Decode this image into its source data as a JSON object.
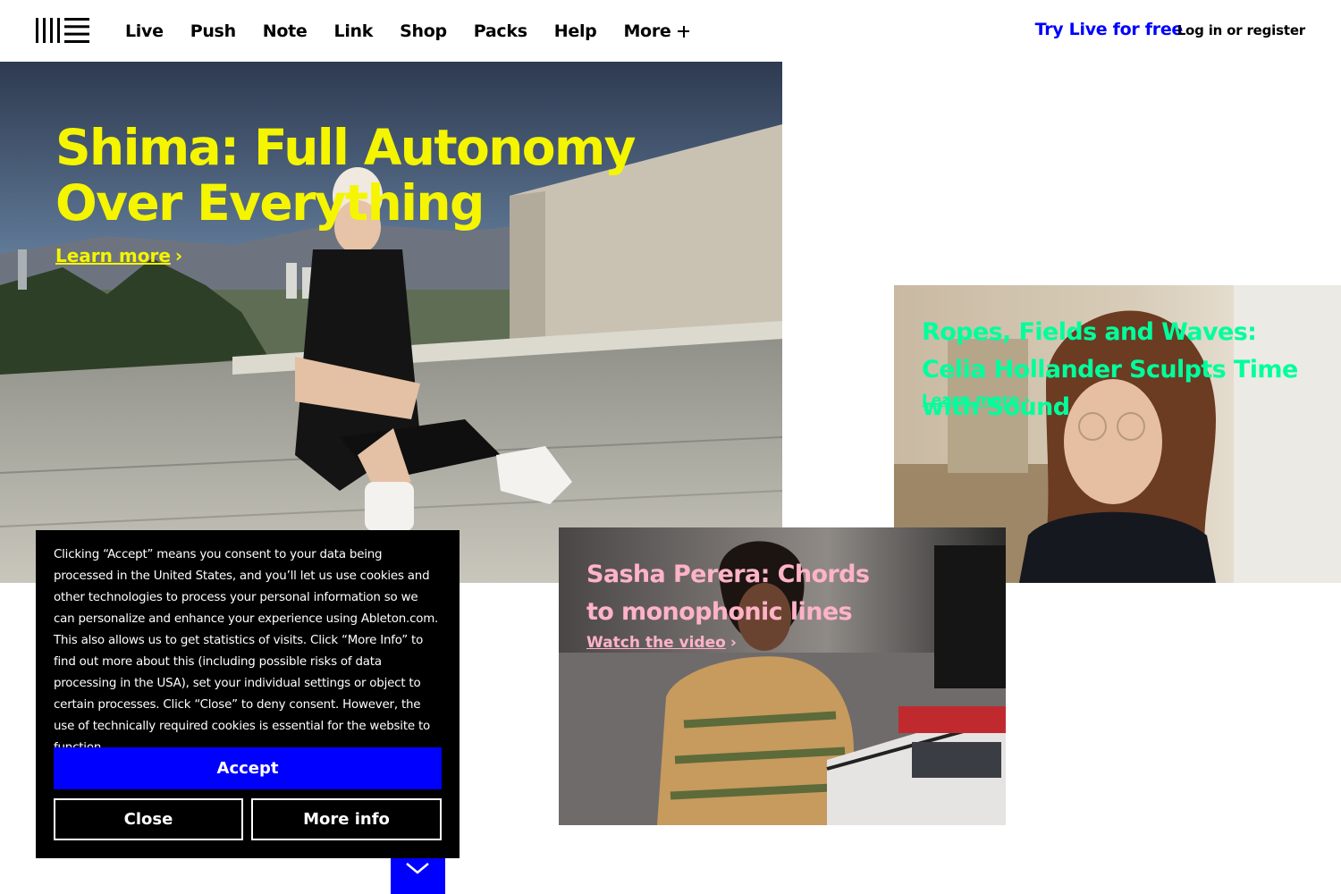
{
  "header": {
    "logo": "ableton-logo",
    "nav": [
      "Live",
      "Push",
      "Note",
      "Link",
      "Shop",
      "Packs",
      "Help",
      "More"
    ],
    "more_icon": "plus-icon",
    "try_live": "Try Live for free",
    "login": "Log in or register"
  },
  "colors": {
    "accent_blue": "#0000ff",
    "hero_text": "#f5f500",
    "celia_text": "#00ff9c",
    "sasha_text": "#ffb3c8"
  },
  "features": {
    "hero": {
      "title": "Shima: Full Autonomy Over Everything",
      "link": "Learn more",
      "chevron": "›"
    },
    "celia": {
      "title": "Ropes, Fields and Waves: Celia Hollander Sculpts Time with Sound",
      "link": "Learn more",
      "chevron": "›"
    },
    "sasha": {
      "title": "Sasha Perera: Chords to monophonic lines",
      "link": "Watch the video",
      "chevron": "›"
    }
  },
  "cookie": {
    "text": "Clicking “Accept” means you consent to your data being processed in the United States, and you’ll let us use cookies and other technologies to process your personal information so we can personalize and enhance your experience using Ableton.com. This also allows us to get statistics of visits. Click “More Info” to find out more about this (including possible risks of data processing in the USA), set your individual settings or object to certain processes. Click “Close” to deny consent. However, the use of technically required cookies is essential for the website to function.",
    "accept": "Accept",
    "close": "Close",
    "more_info": "More info"
  },
  "scroll_button_icon": "chevron-down-icon"
}
